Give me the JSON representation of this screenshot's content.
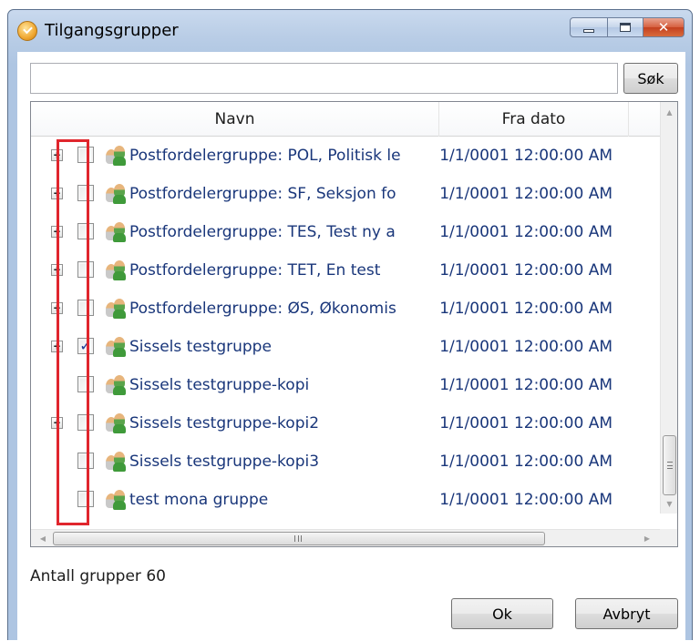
{
  "window": {
    "title": "Tilgangsgrupper",
    "close_glyph": "✕"
  },
  "search": {
    "value": "",
    "button_label": "Søk"
  },
  "grid": {
    "columns": [
      "Navn",
      "Fra dato"
    ],
    "rows": [
      {
        "expandable": true,
        "checked": false,
        "name": "Postfordelergruppe: POL, Politisk le",
        "from_date": "1/1/0001 12:00:00 AM"
      },
      {
        "expandable": true,
        "checked": false,
        "name": "Postfordelergruppe: SF, Seksjon fo",
        "from_date": "1/1/0001 12:00:00 AM"
      },
      {
        "expandable": true,
        "checked": false,
        "name": "Postfordelergruppe: TES, Test ny a",
        "from_date": "1/1/0001 12:00:00 AM"
      },
      {
        "expandable": true,
        "checked": false,
        "name": "Postfordelergruppe: TET, En test",
        "from_date": "1/1/0001 12:00:00 AM"
      },
      {
        "expandable": true,
        "checked": false,
        "name": "Postfordelergruppe: ØS, Økonomis",
        "from_date": "1/1/0001 12:00:00 AM"
      },
      {
        "expandable": true,
        "checked": true,
        "name": "Sissels testgruppe",
        "from_date": "1/1/0001 12:00:00 AM"
      },
      {
        "expandable": false,
        "checked": false,
        "name": "Sissels testgruppe-kopi",
        "from_date": "1/1/0001 12:00:00 AM"
      },
      {
        "expandable": true,
        "checked": false,
        "name": "Sissels testgruppe-kopi2",
        "from_date": "1/1/0001 12:00:00 AM"
      },
      {
        "expandable": false,
        "checked": false,
        "name": "Sissels testgruppe-kopi3",
        "from_date": "1/1/0001 12:00:00 AM"
      },
      {
        "expandable": false,
        "checked": false,
        "name": "test mona gruppe",
        "from_date": "1/1/0001 12:00:00 AM"
      }
    ],
    "expander_glyph": "+",
    "check_glyph": "✓",
    "scroll_arrows": {
      "up": "▲",
      "down": "▼",
      "left": "◀",
      "right": "▶"
    }
  },
  "status": {
    "text": "Antall grupper 60"
  },
  "footer": {
    "ok_label": "Ok",
    "cancel_label": "Avbryt"
  },
  "colors": {
    "highlight": "#e0262d",
    "link_text": "#19367a"
  }
}
